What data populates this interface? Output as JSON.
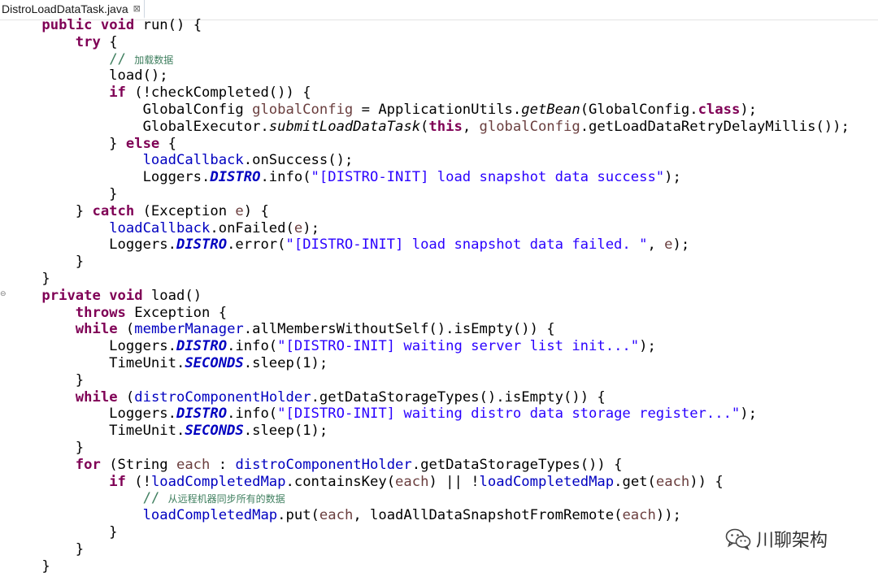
{
  "tab": {
    "title": "DistroLoadDataTask.java",
    "close_glyph": "⊠"
  },
  "watermark": {
    "text": "川聊架构",
    "icon": "wechat-icon"
  },
  "colors": {
    "keyword": "#7f0055",
    "field": "#0000c0",
    "string": "#2a00ff",
    "local_variable": "#6a3e3e",
    "comment": "#3f7f5f"
  },
  "code": {
    "comment_load_data": "加载数据",
    "comment_sync_all": "从远程机器同步所有的数据",
    "str_load_success": "\"[DISTRO-INIT] load snapshot data success\"",
    "str_load_failed": "\"[DISTRO-INIT] load snapshot data failed. \"",
    "str_waiting_server": "\"[DISTRO-INIT] waiting server list init...\"",
    "str_waiting_storage": "\"[DISTRO-INIT] waiting distro data storage register...\""
  }
}
